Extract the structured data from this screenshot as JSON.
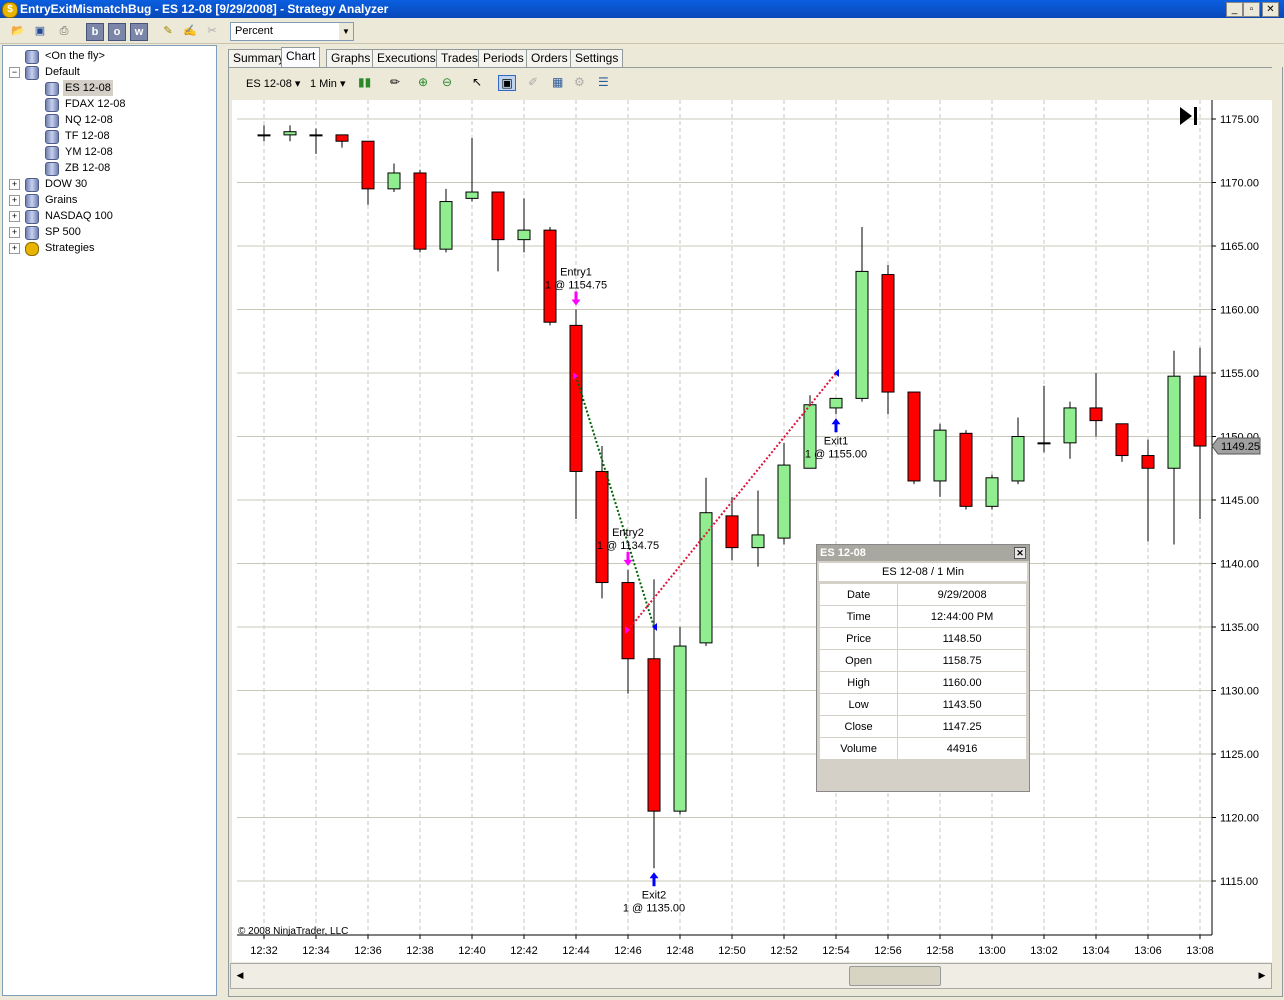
{
  "window": {
    "title": "EntryExitMismatchBug - ES 12-08 [9/29/2008] - Strategy Analyzer"
  },
  "toolbar": {
    "dropdown_value": "Percent"
  },
  "tree": [
    {
      "label": "<On the fly>",
      "depth": 1
    },
    {
      "label": "Default",
      "depth": 0,
      "expander": "−"
    },
    {
      "label": "ES 12-08",
      "depth": 2,
      "selected": true
    },
    {
      "label": "FDAX 12-08",
      "depth": 2
    },
    {
      "label": "NQ 12-08",
      "depth": 2
    },
    {
      "label": "TF 12-08",
      "depth": 2
    },
    {
      "label": "YM 12-08",
      "depth": 2
    },
    {
      "label": "ZB 12-08",
      "depth": 2
    },
    {
      "label": "DOW 30",
      "depth": 0,
      "expander": "+"
    },
    {
      "label": "Grains",
      "depth": 0,
      "expander": "+"
    },
    {
      "label": "NASDAQ 100",
      "depth": 0,
      "expander": "+"
    },
    {
      "label": "SP 500",
      "depth": 0,
      "expander": "+"
    },
    {
      "label": "Strategies",
      "depth": 0,
      "expander": "+",
      "gear": true
    }
  ],
  "tabs": [
    {
      "label": "Summary"
    },
    {
      "label": "Chart",
      "active": true
    },
    {
      "label": "Graphs"
    },
    {
      "label": "Executions"
    },
    {
      "label": "Trades"
    },
    {
      "label": "Periods"
    },
    {
      "label": "Orders"
    },
    {
      "label": "Settings"
    }
  ],
  "chart_tools": {
    "instrument": "ES 12-08",
    "interval": "1 Min"
  },
  "colors": {
    "up": "#90ee90",
    "down": "#ff0000",
    "entry": "#ff00ff",
    "exit": "#0000ff"
  },
  "chart_data": {
    "type": "candlestick",
    "instrument": "ES 12-08",
    "copyright": "© 2008 NinjaTrader, LLC",
    "ylim": [
      1111,
      1178
    ],
    "y_ticks": [
      "1175.00",
      "1170.00",
      "1165.00",
      "1160.00",
      "1155.00",
      "1150.00",
      "1145.00",
      "1140.00",
      "1135.00",
      "1130.00",
      "1125.00",
      "1120.00",
      "1115.00"
    ],
    "x_ticks": [
      "12:32",
      "12:34",
      "12:36",
      "12:38",
      "12:40",
      "12:42",
      "12:44",
      "12:46",
      "12:48",
      "12:50",
      "12:52",
      "12:54",
      "12:56",
      "12:58",
      "13:00",
      "13:02",
      "13:04",
      "13:06",
      "13:08"
    ],
    "last_price": "1149.25",
    "candles": [
      {
        "t": "12:32",
        "o": 1173.75,
        "h": 1174.5,
        "l": 1173.25,
        "c": 1173.75
      },
      {
        "t": "12:33",
        "o": 1173.75,
        "h": 1174.5,
        "l": 1173.25,
        "c": 1174.0
      },
      {
        "t": "12:34",
        "o": 1173.75,
        "h": 1174.25,
        "l": 1172.25,
        "c": 1173.75
      },
      {
        "t": "12:35",
        "o": 1173.75,
        "h": 1173.75,
        "l": 1172.75,
        "c": 1173.25
      },
      {
        "t": "12:36",
        "o": 1173.25,
        "h": 1173.25,
        "l": 1168.25,
        "c": 1169.5
      },
      {
        "t": "12:37",
        "o": 1169.5,
        "h": 1171.5,
        "l": 1169.25,
        "c": 1170.75
      },
      {
        "t": "12:38",
        "o": 1170.75,
        "h": 1171.0,
        "l": 1164.5,
        "c": 1164.75
      },
      {
        "t": "12:39",
        "o": 1164.75,
        "h": 1169.5,
        "l": 1164.5,
        "c": 1168.5
      },
      {
        "t": "12:40",
        "o": 1168.75,
        "h": 1173.5,
        "l": 1168.5,
        "c": 1169.25
      },
      {
        "t": "12:41",
        "o": 1169.25,
        "h": 1169.25,
        "l": 1163.0,
        "c": 1165.5
      },
      {
        "t": "12:42",
        "o": 1165.5,
        "h": 1168.75,
        "l": 1164.5,
        "c": 1166.25
      },
      {
        "t": "12:43",
        "o": 1166.25,
        "h": 1166.5,
        "l": 1158.75,
        "c": 1159.0
      },
      {
        "t": "12:44",
        "o": 1158.75,
        "h": 1160.0,
        "l": 1143.5,
        "c": 1147.25
      },
      {
        "t": "12:45",
        "o": 1147.25,
        "h": 1149.25,
        "l": 1137.25,
        "c": 1138.5
      },
      {
        "t": "12:46",
        "o": 1138.5,
        "h": 1139.5,
        "l": 1129.75,
        "c": 1132.5
      },
      {
        "t": "12:47",
        "o": 1132.5,
        "h": 1138.75,
        "l": 1116.0,
        "c": 1120.5
      },
      {
        "t": "12:48",
        "o": 1120.5,
        "h": 1135.0,
        "l": 1120.25,
        "c": 1133.5
      },
      {
        "t": "12:49",
        "o": 1133.75,
        "h": 1146.75,
        "l": 1133.5,
        "c": 1144.0
      },
      {
        "t": "12:50",
        "o": 1143.75,
        "h": 1145.25,
        "l": 1140.25,
        "c": 1141.25
      },
      {
        "t": "12:51",
        "o": 1141.25,
        "h": 1145.75,
        "l": 1139.75,
        "c": 1142.25
      },
      {
        "t": "12:52",
        "o": 1142.0,
        "h": 1149.5,
        "l": 1141.5,
        "c": 1147.75
      },
      {
        "t": "12:53",
        "o": 1147.5,
        "h": 1153.25,
        "l": 1147.5,
        "c": 1152.5
      },
      {
        "t": "12:54",
        "o": 1152.25,
        "h": 1153.0,
        "l": 1151.75,
        "c": 1153.0
      },
      {
        "t": "12:55",
        "o": 1153.0,
        "h": 1166.5,
        "l": 1152.75,
        "c": 1163.0
      },
      {
        "t": "12:56",
        "o": 1162.75,
        "h": 1163.5,
        "l": 1151.75,
        "c": 1153.5
      },
      {
        "t": "12:57",
        "o": 1153.5,
        "h": 1153.5,
        "l": 1146.25,
        "c": 1146.5
      },
      {
        "t": "12:58",
        "o": 1146.5,
        "h": 1151.0,
        "l": 1145.25,
        "c": 1150.5
      },
      {
        "t": "12:59",
        "o": 1150.25,
        "h": 1150.5,
        "l": 1144.25,
        "c": 1144.5
      },
      {
        "t": "13:00",
        "o": 1144.5,
        "h": 1147.0,
        "l": 1144.25,
        "c": 1146.75
      },
      {
        "t": "13:01",
        "o": 1146.5,
        "h": 1151.5,
        "l": 1146.25,
        "c": 1150.0
      },
      {
        "t": "13:02",
        "o": 1149.5,
        "h": 1154.0,
        "l": 1148.75,
        "c": 1149.5
      },
      {
        "t": "13:03",
        "o": 1149.5,
        "h": 1152.75,
        "l": 1148.25,
        "c": 1152.25
      },
      {
        "t": "13:04",
        "o": 1152.25,
        "h": 1155.0,
        "l": 1150.0,
        "c": 1151.25
      },
      {
        "t": "13:05",
        "o": 1151.0,
        "h": 1151.0,
        "l": 1148.0,
        "c": 1148.5
      },
      {
        "t": "13:06",
        "o": 1148.5,
        "h": 1149.75,
        "l": 1141.75,
        "c": 1147.5
      },
      {
        "t": "13:07",
        "o": 1147.5,
        "h": 1156.75,
        "l": 1141.5,
        "c": 1154.75
      },
      {
        "t": "13:08",
        "o": 1154.75,
        "h": 1157.0,
        "l": 1143.5,
        "c": 1149.25
      }
    ],
    "executions": [
      {
        "name": "Entry1",
        "detail": "1 @ 1154.75",
        "t": "12:44",
        "price": 1154.75,
        "kind": "entry"
      },
      {
        "name": "Entry2",
        "detail": "1 @ 1134.75",
        "t": "12:46",
        "price": 1134.75,
        "kind": "entry"
      },
      {
        "name": "Exit1",
        "detail": "1 @ 1155.00",
        "t": "12:54",
        "price": 1155.0,
        "kind": "exit"
      },
      {
        "name": "Exit2",
        "detail": "1 @ 1135.00",
        "t": "12:47",
        "price": 1135.0,
        "kind": "exit"
      }
    ],
    "trade_lines": [
      {
        "from_t": "12:44",
        "from_p": 1154.75,
        "to_t": "12:47",
        "to_p": 1135.0,
        "color": "#006400"
      },
      {
        "from_t": "12:46",
        "from_p": 1134.75,
        "to_t": "12:54",
        "to_p": 1155.0,
        "color": "#dc143c"
      }
    ]
  },
  "data_box": {
    "title": "ES 12-08",
    "subtitle": "ES 12-08 / 1 Min",
    "rows": [
      {
        "k": "Date",
        "v": "9/29/2008"
      },
      {
        "k": "Time",
        "v": "12:44:00 PM"
      },
      {
        "k": "Price",
        "v": "1148.50"
      },
      {
        "k": "Open",
        "v": "1158.75"
      },
      {
        "k": "High",
        "v": "1160.00"
      },
      {
        "k": "Low",
        "v": "1143.50"
      },
      {
        "k": "Close",
        "v": "1147.25"
      },
      {
        "k": "Volume",
        "v": "44916"
      }
    ]
  }
}
